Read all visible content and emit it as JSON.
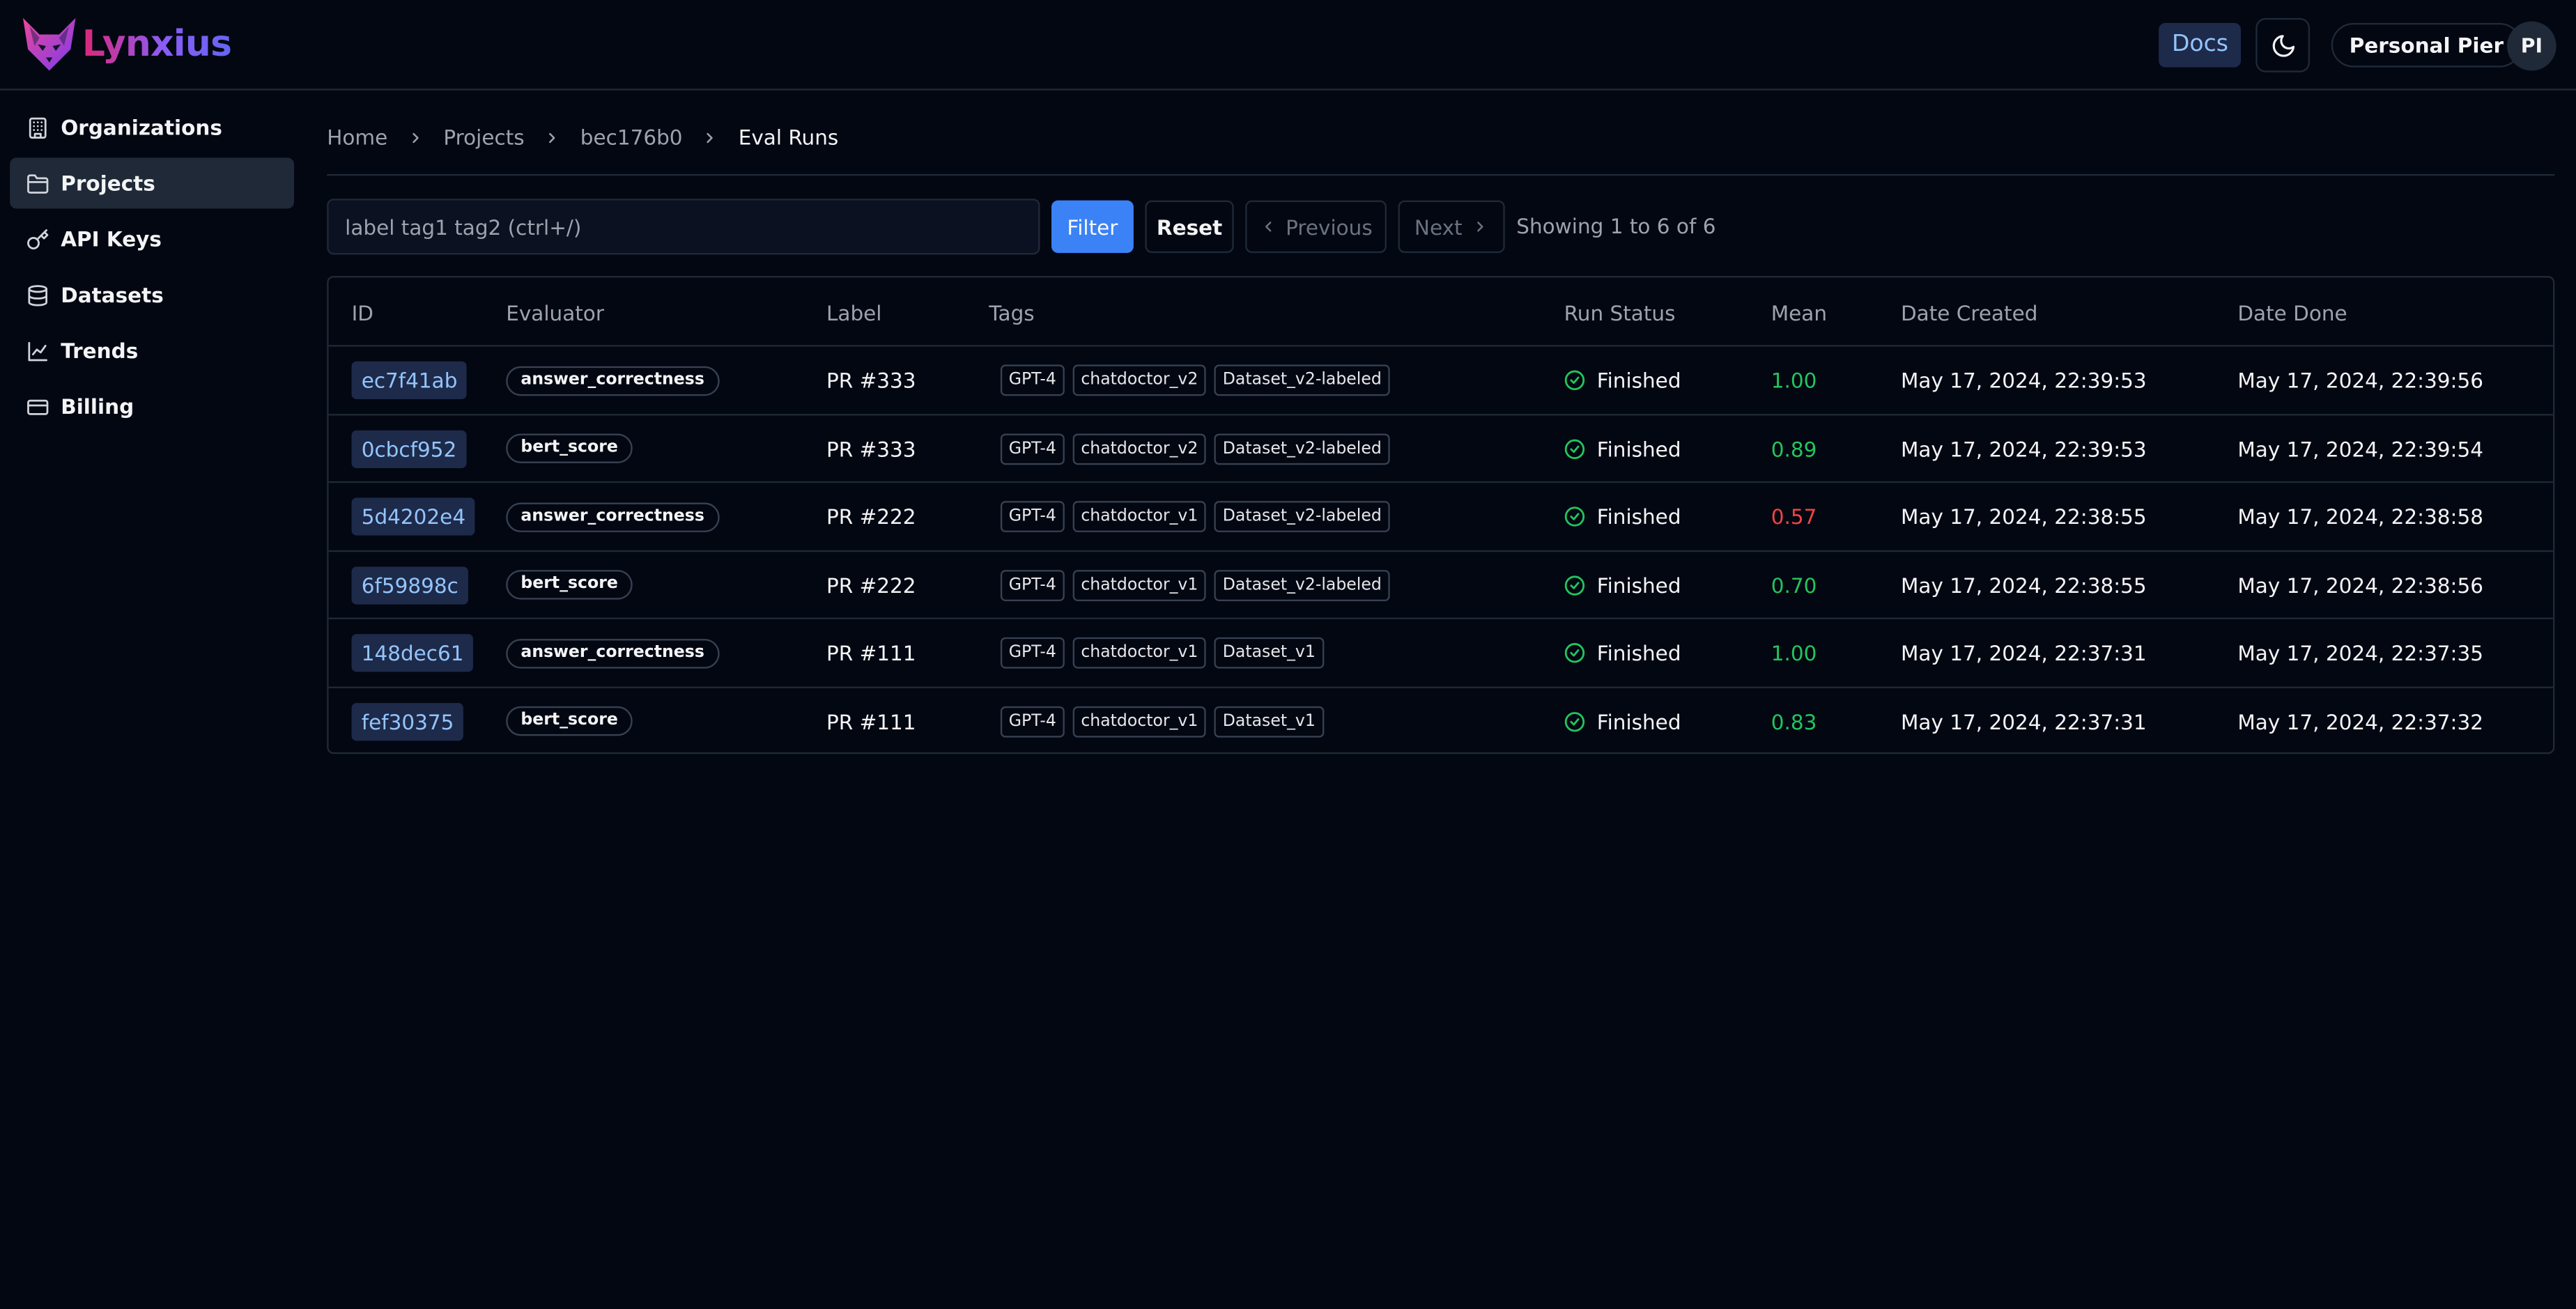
{
  "app": {
    "brand": "Lynxius",
    "accent": "#3b82f6"
  },
  "header": {
    "docs_label": "Docs",
    "user_label": "Personal Pier",
    "avatar_initials": "PI"
  },
  "sidebar": {
    "items": [
      {
        "label": "Organizations",
        "icon": "building-icon"
      },
      {
        "label": "Projects",
        "icon": "folder-icon",
        "active": true
      },
      {
        "label": "API Keys",
        "icon": "key-icon"
      },
      {
        "label": "Datasets",
        "icon": "database-icon"
      },
      {
        "label": "Trends",
        "icon": "chart-line-icon"
      },
      {
        "label": "Billing",
        "icon": "credit-card-icon"
      }
    ]
  },
  "breadcrumb": {
    "items": [
      "Home",
      "Projects",
      "bec176b0"
    ],
    "current": "Eval Runs"
  },
  "toolbar": {
    "search_placeholder": "label tag1 tag2 (ctrl+/)",
    "filter_label": "Filter",
    "reset_label": "Reset",
    "prev_label": "Previous",
    "next_label": "Next",
    "showing_text": "Showing 1 to 6 of 6"
  },
  "table": {
    "columns": [
      "ID",
      "Evaluator",
      "Label",
      "Tags",
      "Run Status",
      "Mean",
      "Date Created",
      "Date Done"
    ],
    "rows": [
      {
        "id": "ec7f41ab",
        "evaluator": "answer_correctness",
        "label": "PR #333",
        "tags": [
          "GPT-4",
          "chatdoctor_v2",
          "Dataset_v2-labeled"
        ],
        "status": "Finished",
        "mean": "1.00",
        "mean_color": "#22c55e",
        "created": "May 17, 2024, 22:39:53",
        "done": "May 17, 2024, 22:39:56"
      },
      {
        "id": "0cbcf952",
        "evaluator": "bert_score",
        "label": "PR #333",
        "tags": [
          "GPT-4",
          "chatdoctor_v2",
          "Dataset_v2-labeled"
        ],
        "status": "Finished",
        "mean": "0.89",
        "mean_color": "#22c55e",
        "created": "May 17, 2024, 22:39:53",
        "done": "May 17, 2024, 22:39:54"
      },
      {
        "id": "5d4202e4",
        "evaluator": "answer_correctness",
        "label": "PR #222",
        "tags": [
          "GPT-4",
          "chatdoctor_v1",
          "Dataset_v2-labeled"
        ],
        "status": "Finished",
        "mean": "0.57",
        "mean_color": "#ef4444",
        "created": "May 17, 2024, 22:38:55",
        "done": "May 17, 2024, 22:38:58"
      },
      {
        "id": "6f59898c",
        "evaluator": "bert_score",
        "label": "PR #222",
        "tags": [
          "GPT-4",
          "chatdoctor_v1",
          "Dataset_v2-labeled"
        ],
        "status": "Finished",
        "mean": "0.70",
        "mean_color": "#22c55e",
        "created": "May 17, 2024, 22:38:55",
        "done": "May 17, 2024, 22:38:56"
      },
      {
        "id": "148dec61",
        "evaluator": "answer_correctness",
        "label": "PR #111",
        "tags": [
          "GPT-4",
          "chatdoctor_v1",
          "Dataset_v1"
        ],
        "status": "Finished",
        "mean": "1.00",
        "mean_color": "#22c55e",
        "created": "May 17, 2024, 22:37:31",
        "done": "May 17, 2024, 22:37:35"
      },
      {
        "id": "fef30375",
        "evaluator": "bert_score",
        "label": "PR #111",
        "tags": [
          "GPT-4",
          "chatdoctor_v1",
          "Dataset_v1"
        ],
        "status": "Finished",
        "mean": "0.83",
        "mean_color": "#22c55e",
        "created": "May 17, 2024, 22:37:31",
        "done": "May 17, 2024, 22:37:32"
      }
    ]
  }
}
